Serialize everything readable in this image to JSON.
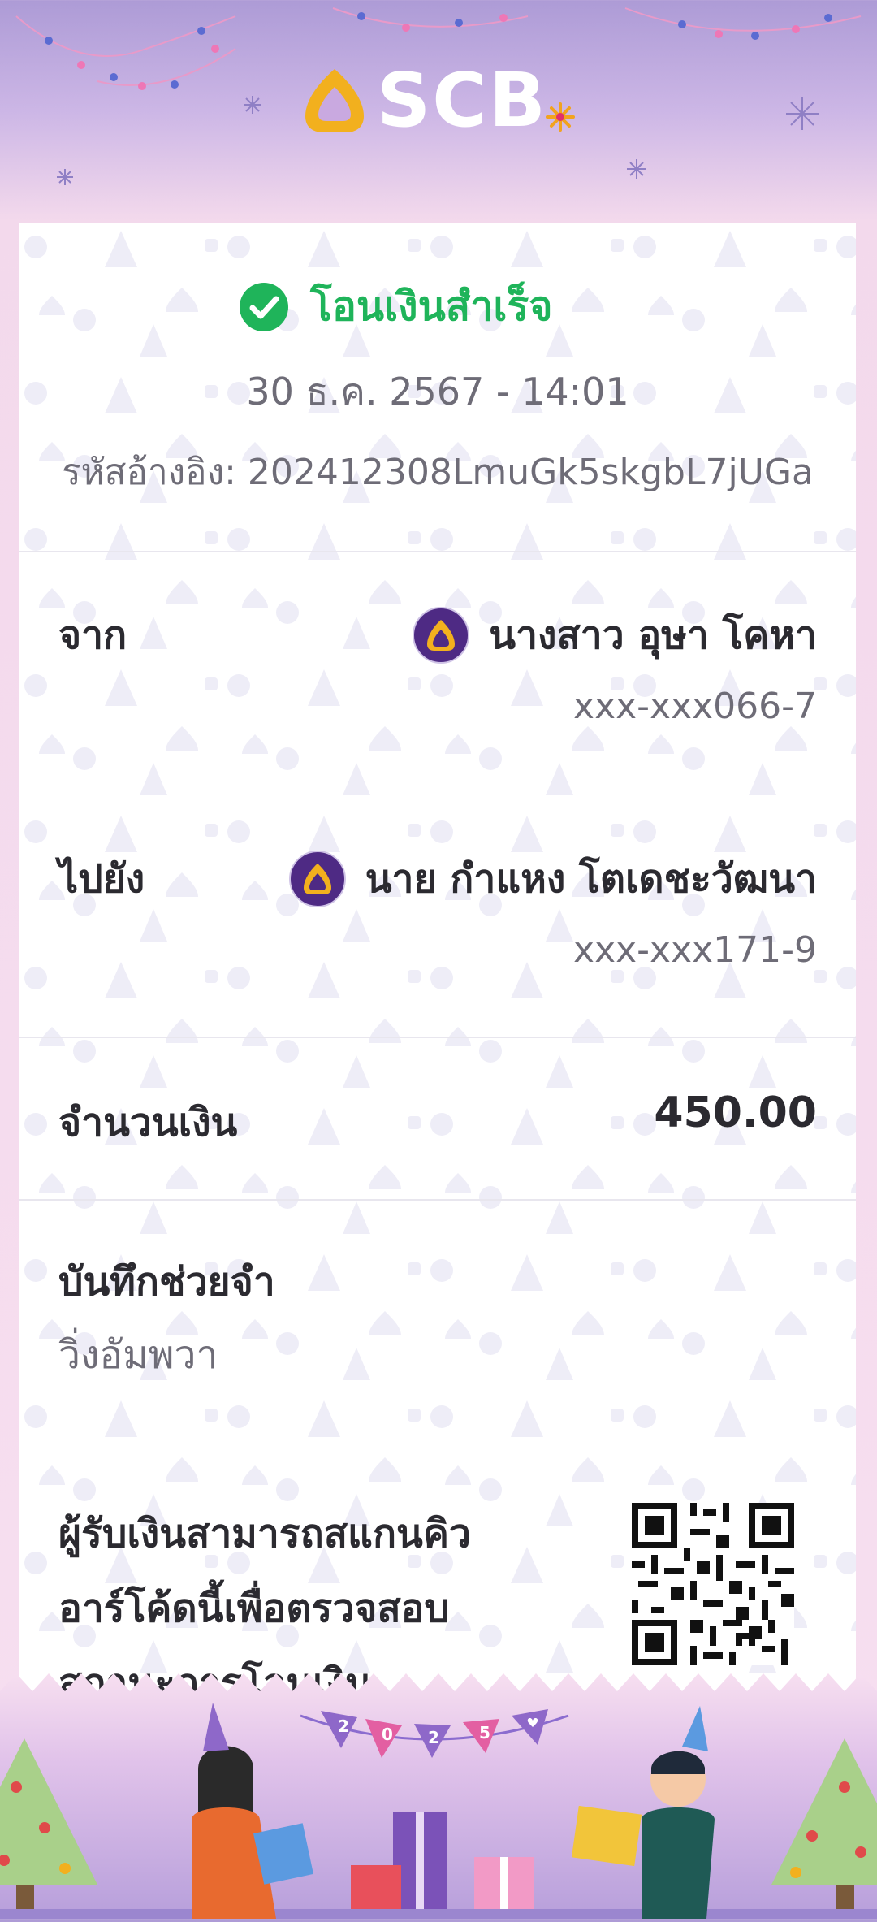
{
  "brand": {
    "name": "SCB"
  },
  "status": {
    "text": "โอนเงินสำเร็จ",
    "icon": "check-circle-icon",
    "color": "#1fb45a"
  },
  "transaction": {
    "datetime": "30 ธ.ค. 2567 - 14:01",
    "reference_label": "รหัสอ้างอิง:",
    "reference": "202412308LmuGk5skgbL7jUGa"
  },
  "from": {
    "label": "จาก",
    "name": "นางสาว อุษา โคหา",
    "account": "xxx-xxx066-7",
    "bank_icon": "scb-bank-icon"
  },
  "to": {
    "label": "ไปยัง",
    "name": "นาย กำแหง โตเดชะวัฒนา",
    "account": "xxx-xxx171-9",
    "bank_icon": "scb-bank-icon"
  },
  "amount": {
    "label": "จำนวนเงิน",
    "value": "450.00"
  },
  "memo": {
    "label": "บันทึกช่วยจำ",
    "value": "วิ่งอัมพวา"
  },
  "qr": {
    "line1": "ผู้รับเงินสามารถสแกนคิว",
    "line2": "อาร์โค้ดนี้เพื่อตรวจสอบ",
    "line3": "สถานะการโอนเงิน"
  },
  "footer": {
    "banner_letters": [
      "2",
      "0",
      "2",
      "5"
    ]
  },
  "colors": {
    "brand_purple": "#4e2a84",
    "brand_gold": "#f2b01e",
    "success_green": "#1fb45a"
  }
}
